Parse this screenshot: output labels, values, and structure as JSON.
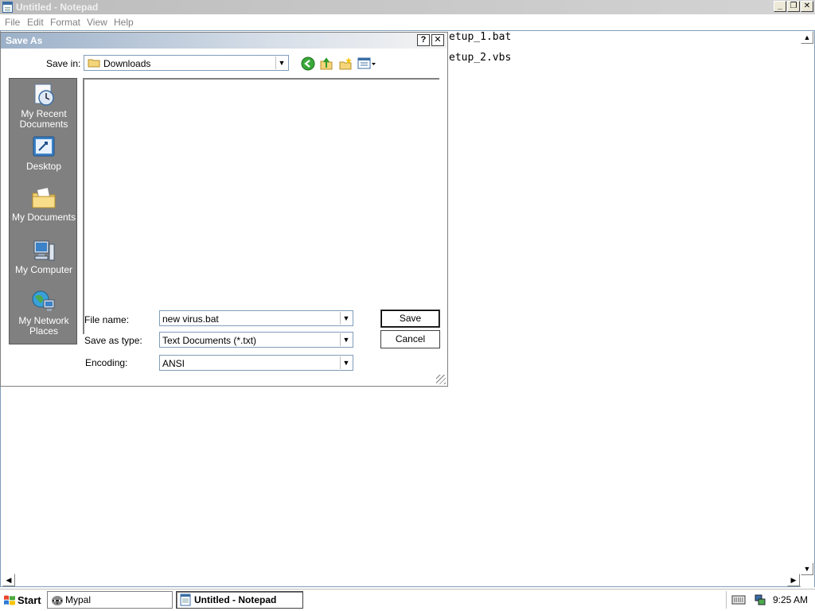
{
  "notepad": {
    "title": "Untitled - Notepad",
    "menu": [
      "File",
      "Edit",
      "Format",
      "View",
      "Help"
    ],
    "lines": [
      "etup_1.bat",
      "etup_2.vbs"
    ],
    "caption_buttons": {
      "minimize": "_",
      "restore": "❐",
      "close": "✕"
    }
  },
  "dialog": {
    "title": "Save As",
    "help_glyph": "?",
    "close_glyph": "✕",
    "save_in_label": "Save in:",
    "save_in_value": "Downloads",
    "places": [
      {
        "label_line1": "My Recent",
        "label_line2": "Documents",
        "icon": "recent-documents-icon"
      },
      {
        "label_line1": "Desktop",
        "label_line2": "",
        "icon": "desktop-icon"
      },
      {
        "label_line1": "My Documents",
        "label_line2": "",
        "icon": "my-documents-icon"
      },
      {
        "label_line1": "My Computer",
        "label_line2": "",
        "icon": "my-computer-icon"
      },
      {
        "label_line1": "My Network",
        "label_line2": "Places",
        "icon": "network-places-icon"
      }
    ],
    "file_name_label": "File name:",
    "file_name_value": "new virus.bat",
    "save_as_type_label": "Save as type:",
    "save_as_type_value": "Text Documents (*.txt)",
    "encoding_label": "Encoding:",
    "encoding_value": "ANSI",
    "save_button": "Save",
    "cancel_button": "Cancel"
  },
  "taskbar": {
    "start_label": "Start",
    "tasks": [
      {
        "label": "Mypal",
        "icon": "raccoon-icon"
      },
      {
        "label": "Untitled - Notepad",
        "icon": "notepad-icon"
      }
    ],
    "clock": "9:25 AM"
  }
}
